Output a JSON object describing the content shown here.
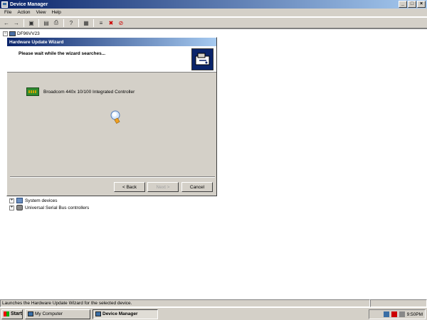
{
  "window": {
    "title": "Device Manager",
    "buttons": [
      "_",
      "□",
      "×"
    ]
  },
  "menu": [
    "File",
    "Action",
    "View",
    "Help"
  ],
  "toolbar": {
    "icons": [
      "back-icon",
      "forward-icon",
      "up-icon",
      "properties-icon",
      "print-icon",
      "help-icon",
      "scan-icon",
      "update-driver-icon",
      "uninstall-icon",
      "disable-icon"
    ]
  },
  "tree": {
    "root": "DF96VV23",
    "items": [
      {
        "label": "System devices"
      },
      {
        "label": "Universal Serial Bus controllers"
      }
    ]
  },
  "wizard": {
    "title": "Hardware Update Wizard",
    "heading": "Please wait while the wizard searches...",
    "device": "Broadcom 440x 10/100 Integrated Controller",
    "back": "< Back",
    "next": "Next >",
    "cancel": "Cancel"
  },
  "status": {
    "text": "Launches the Hardware Update Wizard for the selected device."
  },
  "taskbar": {
    "start": "Start",
    "tasks": [
      {
        "label": "My Computer"
      },
      {
        "label": "Device Manager"
      }
    ],
    "clock": "9:50PM"
  }
}
